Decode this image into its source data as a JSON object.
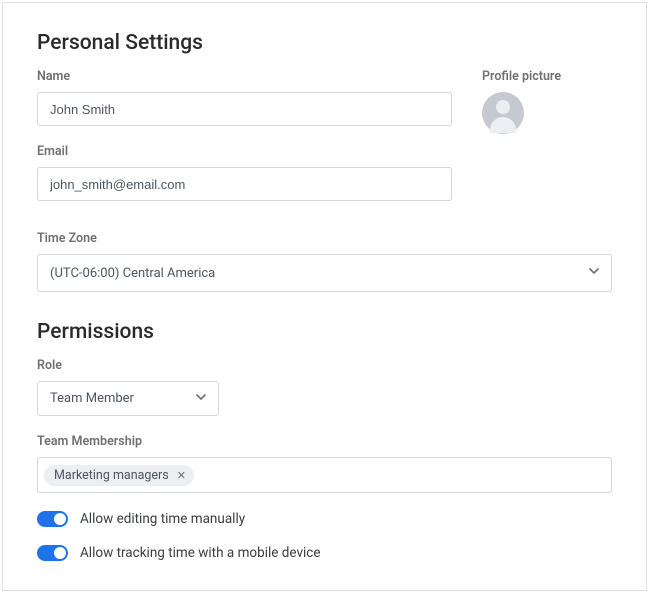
{
  "personal": {
    "heading": "Personal Settings",
    "name_label": "Name",
    "name_value": "John Smith",
    "email_label": "Email",
    "email_value": "john_smith@email.com",
    "picture_label": "Profile picture",
    "tz_label": "Time Zone",
    "tz_value": "(UTC-06:00) Central America"
  },
  "permissions": {
    "heading": "Permissions",
    "role_label": "Role",
    "role_value": "Team Member",
    "membership_label": "Team Membership",
    "membership_tags": [
      "Marketing managers"
    ],
    "toggle_edit_label": "Allow editing time manually",
    "toggle_edit_on": true,
    "toggle_mobile_label": "Allow tracking time with a mobile device",
    "toggle_mobile_on": true
  }
}
